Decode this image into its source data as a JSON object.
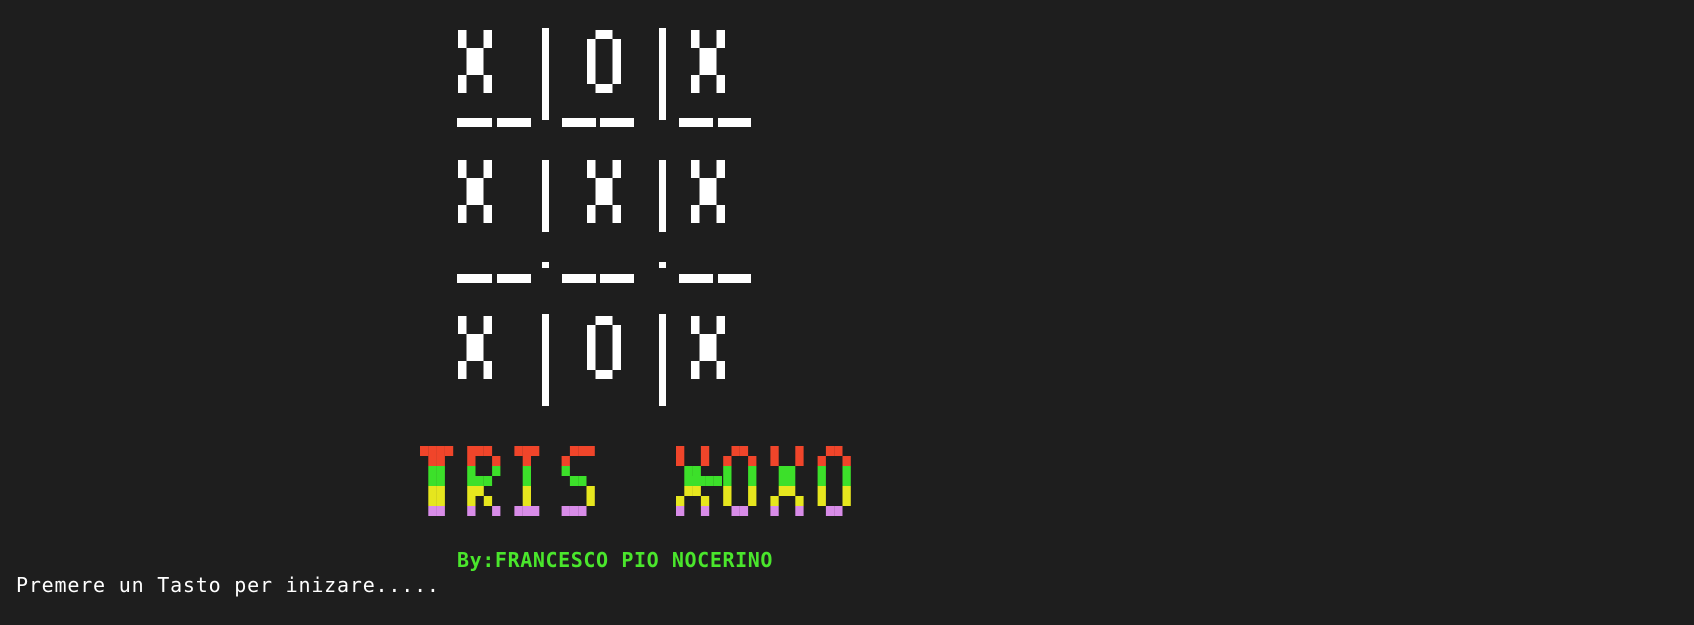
{
  "terminal": {
    "background": "#1e1e1e",
    "foreground": "#ffffff"
  },
  "board": {
    "rows": [
      [
        "X",
        "O",
        "X"
      ],
      [
        "X",
        "X",
        "X"
      ],
      [
        "X",
        "O",
        "X"
      ]
    ],
    "color": "#ffffff"
  },
  "title": {
    "text": "TRIS-XOXO",
    "band_colors": [
      "#f0452a",
      "#3ce02a",
      "#e6e61e",
      "#d88ce8"
    ]
  },
  "credit": {
    "text": "By:FRANCESCO PIO NOCERINO",
    "color": "#4ae62c"
  },
  "prompt": {
    "text": "Premere un Tasto per inizare....."
  }
}
